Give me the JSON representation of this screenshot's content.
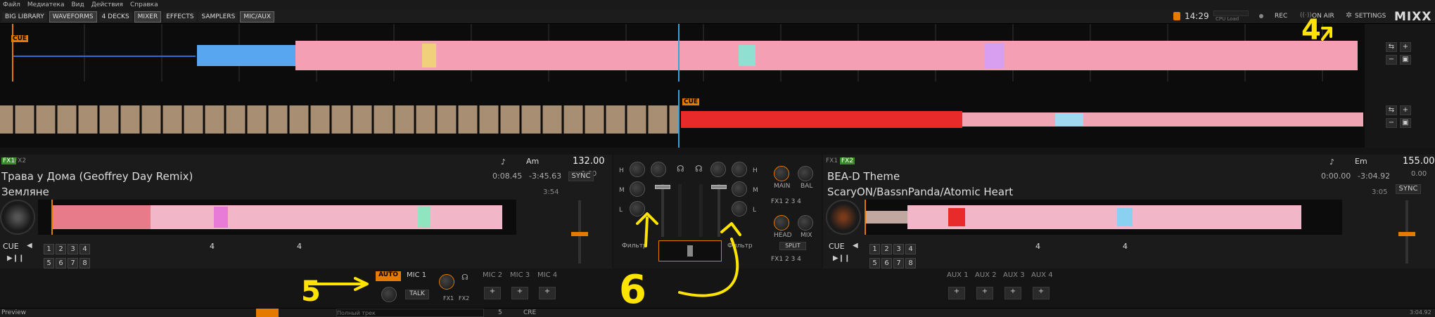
{
  "menu": [
    "Файл",
    "Медиатека",
    "Вид",
    "Действия",
    "Справка"
  ],
  "toolbar": {
    "library": "BIG LIBRARY",
    "waveforms": "WAVEFORMS",
    "decks": "4 DECKS",
    "mixer": "MIXER",
    "effects": "EFFECTS",
    "samplers": "SAMPLERS",
    "mic_aux": "MIC/AUX",
    "clock": "14:29",
    "cpu": "CPU Load",
    "rec": "REC",
    "on_air": "ON AIR",
    "settings": "SETTINGS",
    "logo": "MIXX"
  },
  "waveform": {
    "cue_label": "CUE"
  },
  "deck1": {
    "fx1": "FX1",
    "fx2": "FX2",
    "key": "Am",
    "bpm": "132.00",
    "bpm_delta": "0.00",
    "title": "Трава у Дома (Geoffrey Day Remix)",
    "artist": "Земляне",
    "time": "0:08.45",
    "remaining": "-3:45.63",
    "duration": "3:54",
    "sync": "SYNC",
    "cue": "CUE",
    "hotcues_top": [
      "1",
      "2",
      "3",
      "4"
    ],
    "hotcues_bottom": [
      "5",
      "6",
      "7",
      "8"
    ],
    "loop_size": "4",
    "beatjump_size": "4"
  },
  "deck2": {
    "fx1": "FX1",
    "fx2": "FX2",
    "key": "Em",
    "bpm": "155.00",
    "bpm_delta": "0.00",
    "title": "BEA-D Theme",
    "artist": "ScaryON/BassnPanda/Atomic Heart",
    "time": "0:00.00",
    "remaining": "-3:04.92",
    "duration": "3:05",
    "sync": "SYNC",
    "cue": "CUE",
    "hotcues_top": [
      "1",
      "2",
      "3",
      "4"
    ],
    "hotcues_bottom": [
      "5",
      "6",
      "7",
      "8"
    ],
    "loop_size": "4",
    "beatjump_size": "4"
  },
  "mixer": {
    "eq": [
      "H",
      "M",
      "L"
    ],
    "filter": "Фильтр",
    "main": "MAIN",
    "bal": "BAL",
    "head": "HEAD",
    "mix": "MIX",
    "split": "SPLIT",
    "fx_units": [
      "FX1",
      "2",
      "3",
      "4"
    ]
  },
  "mic": {
    "auto": "AUTO",
    "mic1": "MIC 1",
    "talk": "TALK",
    "fx1": "FX1",
    "fx2": "FX2",
    "others": [
      "MIC 2",
      "MIC 3",
      "MIC 4"
    ],
    "aux": [
      "AUX 1",
      "AUX 2",
      "AUX 3",
      "AUX 4"
    ]
  },
  "library": {
    "preview": "Preview",
    "search_placeholder": "Полный трек",
    "count": "5",
    "crate": "CRE",
    "end_time": "3:04.92"
  },
  "annotations": [
    "4",
    "5",
    "6"
  ],
  "colors": {
    "accent": "#e57a00",
    "annotation": "#ffe400",
    "fx_active": "#3a8a2a"
  }
}
